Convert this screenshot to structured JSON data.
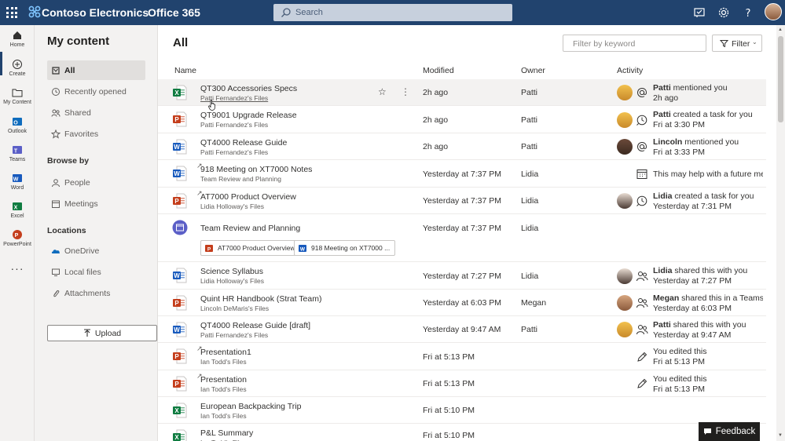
{
  "topbar": {
    "brand": "Contoso Electronics",
    "suite": "Office 365",
    "search_placeholder": "Search"
  },
  "rail": [
    {
      "label": "Home",
      "icon": "home-icon"
    },
    {
      "label": "Create",
      "icon": "plus-circle-icon"
    },
    {
      "label": "My Content",
      "icon": "folder-icon"
    },
    {
      "label": "Outlook",
      "icon": "outlook-icon"
    },
    {
      "label": "Teams",
      "icon": "teams-icon"
    },
    {
      "label": "Word",
      "icon": "word-icon"
    },
    {
      "label": "Excel",
      "icon": "excel-icon"
    },
    {
      "label": "PowerPoint",
      "icon": "powerpoint-icon"
    }
  ],
  "nav": {
    "title": "My content",
    "items": [
      {
        "label": "All",
        "icon": "all-icon"
      },
      {
        "label": "Recently opened",
        "icon": "clock-icon"
      },
      {
        "label": "Shared",
        "icon": "people-icon"
      },
      {
        "label": "Favorites",
        "icon": "star-icon"
      }
    ],
    "browse_by": "Browse by",
    "browse_items": [
      {
        "label": "People",
        "icon": "person-icon"
      },
      {
        "label": "Meetings",
        "icon": "calendar-icon"
      }
    ],
    "locations": "Locations",
    "location_items": [
      {
        "label": "OneDrive",
        "icon": "onedrive-icon"
      },
      {
        "label": "Local files",
        "icon": "computer-icon"
      },
      {
        "label": "Attachments",
        "icon": "paperclip-icon"
      }
    ],
    "upload": "Upload"
  },
  "main": {
    "title": "All",
    "filter_placeholder": "Filter by keyword",
    "filter_label": "Filter",
    "columns": [
      "Name",
      "Modified",
      "Owner",
      "Activity"
    ]
  },
  "files": [
    {
      "type": "excel",
      "name": "QT300 Accessories Specs",
      "location": "Patti Fernandez's Files",
      "modified": "2h ago",
      "owner": "Patti",
      "activity_who": "Patti",
      "activity_what": " mentioned you",
      "activity_when": "2h ago",
      "activity_icon": "at-icon"
    },
    {
      "type": "powerpoint",
      "name": "QT9001 Upgrade Release",
      "location": "Patti Fernandez's Files",
      "modified": "2h ago",
      "owner": "Patti",
      "activity_who": "Patti",
      "activity_what": " created a task for you",
      "activity_when": "Fri at 3:30 PM",
      "activity_icon": "task-icon"
    },
    {
      "type": "word",
      "name": "QT4000 Release Guide",
      "location": "Patti Fernandez's Files",
      "modified": "2h ago",
      "owner": "Patti",
      "activity_who": "Lincoln",
      "activity_what": " mentioned you",
      "activity_when": "Fri at 3:33 PM",
      "activity_icon": "at-icon"
    },
    {
      "type": "word",
      "name": "918 Meeting on XT7000 Notes",
      "location": "Team Review and Planning",
      "modified": "Yesterday at 7:37 PM",
      "owner": "Lidia",
      "activity_who": "",
      "activity_what": "This may help with a future mee...",
      "activity_when": "",
      "activity_icon": "calendar-icon"
    },
    {
      "type": "powerpoint",
      "name": "AT7000 Product Overview",
      "location": "Lidia Holloway's Files",
      "modified": "Yesterday at 7:37 PM",
      "owner": "Lidia",
      "activity_who": "Lidia",
      "activity_what": " created a task for you",
      "activity_when": "Yesterday at 7:31 PM",
      "activity_icon": "task-icon"
    },
    {
      "type": "meeting",
      "name": "Team Review and Planning",
      "location": "",
      "modified": "Yesterday at 7:37 PM",
      "owner": "Lidia",
      "chips": [
        "AT7000 Product Overview",
        "918 Meeting on XT7000 ..."
      ]
    },
    {
      "type": "word",
      "name": "Science Syllabus",
      "location": "Lidia Holloway's Files",
      "modified": "Yesterday at 7:27 PM",
      "owner": "Lidia",
      "activity_who": "Lidia",
      "activity_what": " shared this with you",
      "activity_when": "Yesterday at 7:27 PM",
      "activity_icon": "share-icon"
    },
    {
      "type": "powerpoint",
      "name": "Quint HR Handbook (Strat Team)",
      "location": "Lincoln DeMaris's Files",
      "modified": "Yesterday at 6:03 PM",
      "owner": "Megan",
      "activity_who": "Megan",
      "activity_what": " shared this in a Teams c...",
      "activity_when": "Yesterday at 6:03 PM",
      "activity_icon": "share-icon"
    },
    {
      "type": "word",
      "name": "QT4000 Release Guide [draft]",
      "location": "Patti Fernandez's Files",
      "modified": "Yesterday at 9:47 AM",
      "owner": "Patti",
      "activity_who": "Patti",
      "activity_what": " shared this with you",
      "activity_when": "Yesterday at 9:47 AM",
      "activity_icon": "share-icon"
    },
    {
      "type": "powerpoint",
      "name": "Presentation1",
      "location": "Ian Todd's Files",
      "modified": "Fri at 5:13 PM",
      "owner": "",
      "activity_who": "",
      "activity_what": "You edited this",
      "activity_when": "Fri at 5:13 PM",
      "activity_icon": "pencil-icon"
    },
    {
      "type": "powerpoint",
      "name": "Presentation",
      "location": "Ian Todd's Files",
      "modified": "Fri at 5:13 PM",
      "owner": "",
      "activity_who": "",
      "activity_what": "You edited this",
      "activity_when": "Fri at 5:13 PM",
      "activity_icon": "pencil-icon"
    },
    {
      "type": "excel",
      "name": "European Backpacking Trip",
      "location": "Ian Todd's Files",
      "modified": "Fri at 5:10 PM",
      "owner": "",
      "activity_who": "",
      "activity_what": "",
      "activity_when": "",
      "activity_icon": ""
    },
    {
      "type": "excel",
      "name": "P&L Summary",
      "location": "Ian Todd's Files",
      "modified": "Fri at 5:10 PM",
      "owner": "",
      "activity_who": "",
      "activity_what": "",
      "activity_when": "",
      "activity_icon": ""
    }
  ],
  "feedback": "Feedback",
  "colors": {
    "topbar": "#21436e",
    "word": "#185abd",
    "excel": "#107c41",
    "powerpoint": "#c43e1c"
  }
}
